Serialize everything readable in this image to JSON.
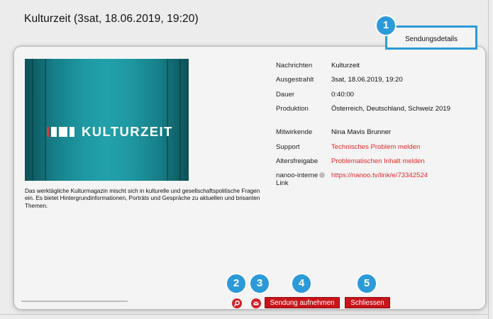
{
  "header": {
    "title": "Kulturzeit (3sat, 18.06.2019, 19:20)"
  },
  "tab": {
    "label": "Sendungsdetails"
  },
  "callouts": [
    "1",
    "2",
    "3",
    "4",
    "5"
  ],
  "thumbnail": {
    "logo_text": "KULTURZEIT"
  },
  "description": "Das werktägliche Kulturmagazin mischt sich in kulturelle und gesellschaftspolitische Fragen ein. Es bietet Hintergrundinformationen, Porträts und Gespräche zu aktuellen und brisanten Themen.",
  "details": [
    {
      "label": "Nachrichten",
      "value": "Kulturzeit"
    },
    {
      "label": "Ausgestrahlt",
      "value": "3sat, 18.06.2019, 19:20"
    },
    {
      "label": "Dauer",
      "value": "0:40:00"
    },
    {
      "label": "Produktion",
      "value": "Österreich, Deutschland, Schweiz 2019"
    },
    {
      "label": "Mitwirkende",
      "value": "Nina Mavis Brunner"
    },
    {
      "label": "Support",
      "value": "Technisches Problem melden"
    },
    {
      "label": "Altersfreigabe",
      "value": "Problematischen Inhalt melden"
    },
    {
      "label": "nanoo-interne Link",
      "value": "https://nanoo.tv/link/e/73342524"
    }
  ],
  "buttons": {
    "record": "Sendung aufnehmen",
    "close": "Schliessen"
  },
  "colors": {
    "accent_blue": "#2c9ad8",
    "action_red": "#c8151b",
    "link_red": "#e32a2a",
    "thumbnail_teal": "#1e97a1"
  }
}
